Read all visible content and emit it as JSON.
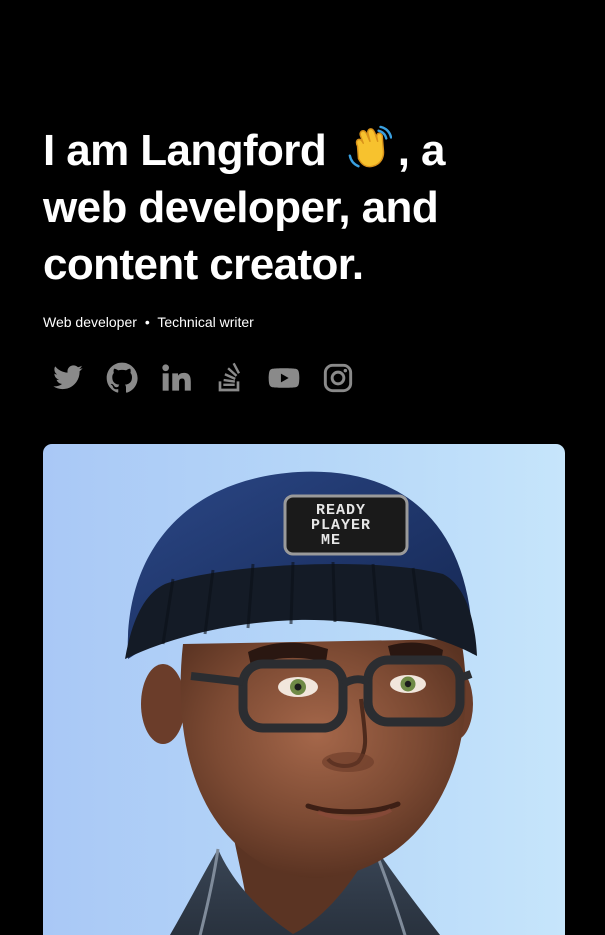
{
  "hero": {
    "line1_pre": "I am Langford ",
    "line1_post": ", a",
    "line2": "web developer, and",
    "line3": "content creator."
  },
  "subtitle": {
    "role1": "Web developer",
    "separator": "•",
    "role2": "Technical writer"
  },
  "socials": {
    "items": [
      "twitter-icon",
      "github-icon",
      "linkedin-icon",
      "stackoverflow-icon",
      "youtube-icon",
      "instagram-icon"
    ],
    "icon_color": "#8a8a8a"
  },
  "avatar": {
    "beanie_patch": "READY PLAYER ME"
  },
  "colors": {
    "background": "#000000",
    "text": "#ffffff"
  }
}
